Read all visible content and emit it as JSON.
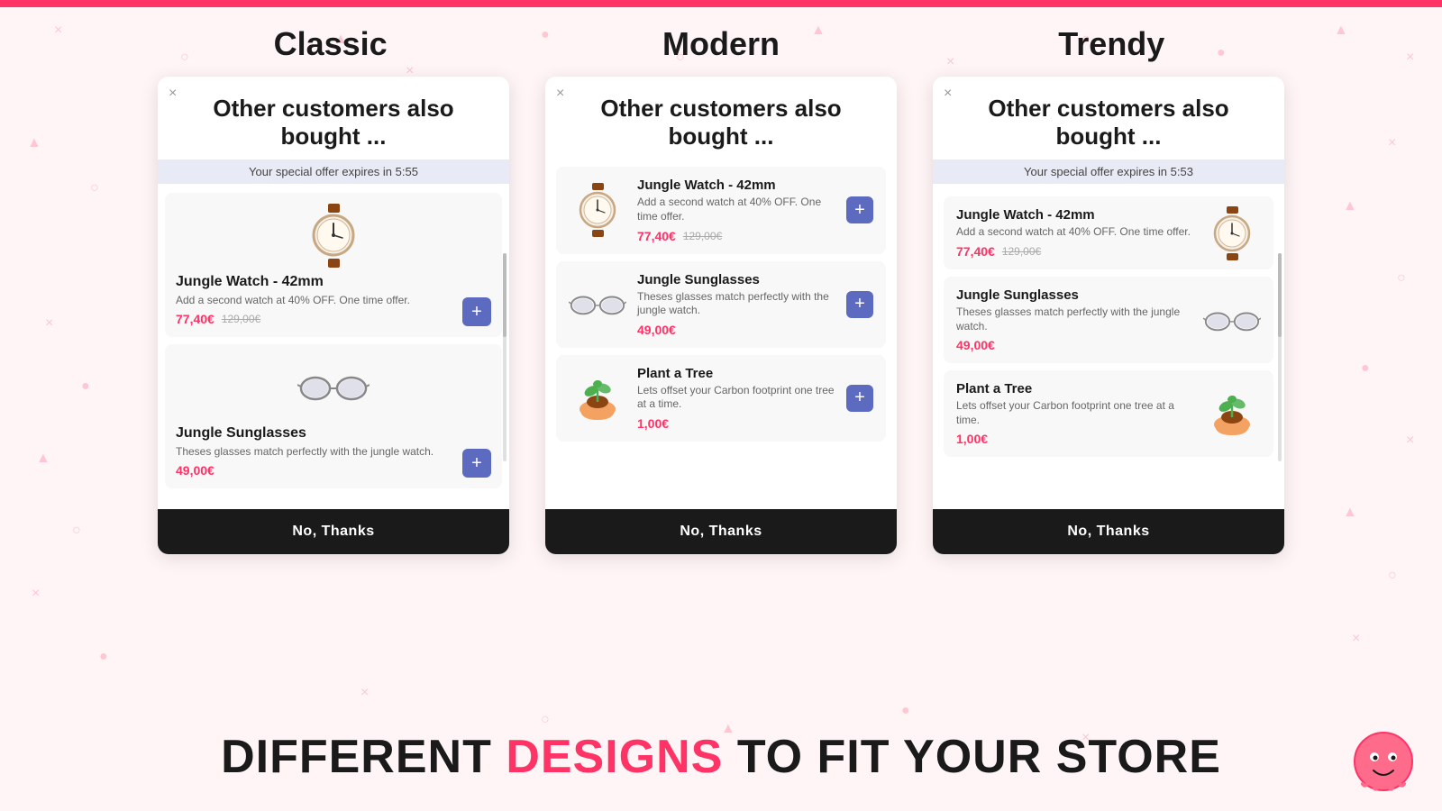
{
  "topBar": {
    "color": "#ff3366"
  },
  "columns": [
    {
      "id": "classic",
      "title": "Classic"
    },
    {
      "id": "modern",
      "title": "Modern"
    },
    {
      "id": "trendy",
      "title": "Trendy"
    }
  ],
  "widgets": [
    {
      "id": "classic",
      "title": "Other customers also bought ...",
      "offer": "Your special offer expires in 5:55",
      "items": [
        {
          "type": "watch",
          "name": "Jungle Watch - 42mm",
          "desc": "Add a second watch at 40% OFF. One time offer.",
          "priceNew": "77,40€",
          "priceOld": "129,00€"
        },
        {
          "type": "sunglasses",
          "name": "Jungle Sunglasses",
          "desc": "Theses glasses match perfectly with the jungle watch.",
          "priceNew": "49,00€",
          "priceOld": ""
        }
      ],
      "noThanks": "No, Thanks"
    },
    {
      "id": "modern",
      "title": "Other customers also bought ...",
      "offer": null,
      "items": [
        {
          "type": "watch",
          "name": "Jungle Watch - 42mm",
          "desc": "Add a second watch at 40% OFF. One time offer.",
          "priceNew": "77,40€",
          "priceOld": "129,00€"
        },
        {
          "type": "sunglasses",
          "name": "Jungle Sunglasses",
          "desc": "Theses glasses match perfectly with the jungle watch.",
          "priceNew": "49,00€",
          "priceOld": ""
        },
        {
          "type": "plant",
          "name": "Plant a Tree",
          "desc": "Lets offset your Carbon footprint one tree at a time.",
          "priceNew": "1,00€",
          "priceOld": ""
        }
      ],
      "noThanks": "No, Thanks"
    },
    {
      "id": "trendy",
      "title": "Other customers also bought ...",
      "offer": "Your special offer expires in 5:53",
      "items": [
        {
          "type": "watch",
          "name": "Jungle Watch - 42mm",
          "desc": "Add a second watch at 40% OFF. One time offer.",
          "priceNew": "77,40€",
          "priceOld": "129,00€"
        },
        {
          "type": "sunglasses",
          "name": "Jungle Sunglasses",
          "desc": "Theses glasses match perfectly with the jungle watch.",
          "priceNew": "49,00€",
          "priceOld": ""
        },
        {
          "type": "plant",
          "name": "Plant a Tree",
          "desc": "Lets offset your Carbon footprint one tree at a time.",
          "priceNew": "1,00€",
          "priceOld": ""
        }
      ],
      "noThanks": "No, Thanks"
    }
  ],
  "bottomText": {
    "part1": "DIFFERENT ",
    "part2": "DESIGNS",
    "part3": " TO FIT YOUR STORE"
  },
  "addLabel": "+"
}
